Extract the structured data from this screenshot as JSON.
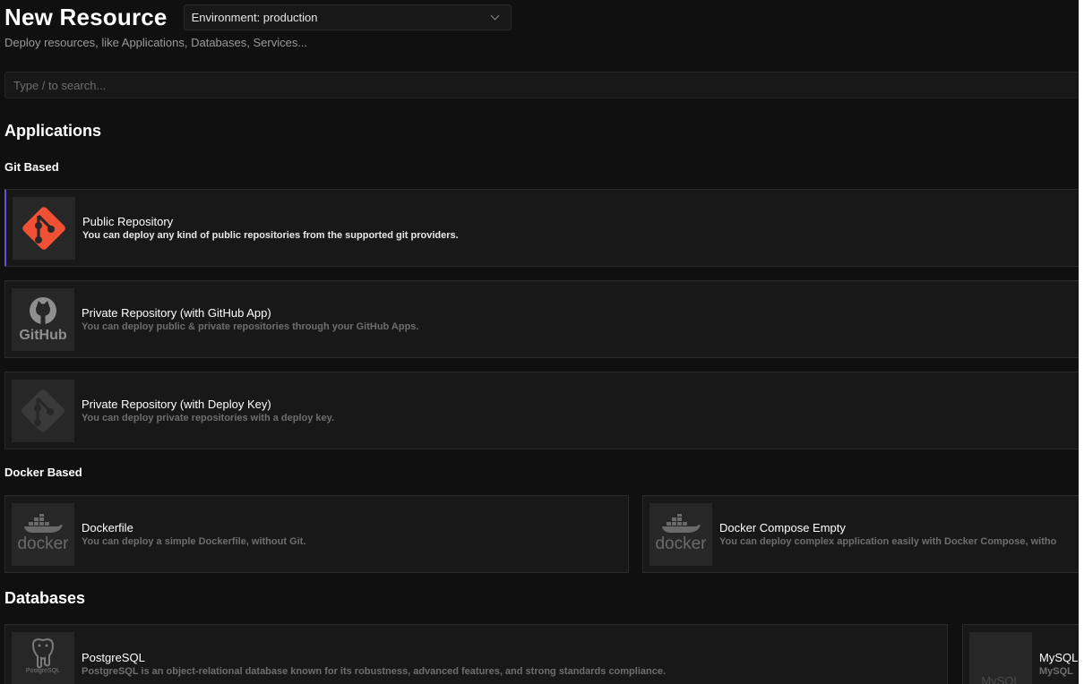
{
  "header": {
    "title": "New Resource",
    "environment_select": "Environment: production",
    "subtitle": "Deploy resources, like Applications, Databases, Services..."
  },
  "search": {
    "placeholder": "Type / to search..."
  },
  "applications": {
    "title": "Applications",
    "git_based": {
      "title": "Git Based",
      "items": [
        {
          "name": "Public Repository",
          "description": "You can deploy any kind of public repositories from the supported git providers.",
          "icon": "git-icon",
          "selected": true
        },
        {
          "name": "Private Repository (with GitHub App)",
          "description": "You can deploy public & private repositories through your GitHub Apps.",
          "icon": "github-icon",
          "logo_text": "GitHub"
        },
        {
          "name": "Private Repository (with Deploy Key)",
          "description": "You can deploy private repositories with a deploy key.",
          "icon": "git-icon"
        }
      ]
    },
    "docker_based": {
      "title": "Docker Based",
      "items": [
        {
          "name": "Dockerfile",
          "description": "You can deploy a simple Dockerfile, without Git.",
          "icon": "docker-icon",
          "logo_text": "docker"
        },
        {
          "name": "Docker Compose Empty",
          "description": "You can deploy complex application easily with Docker Compose, witho",
          "icon": "docker-icon",
          "logo_text": "docker"
        }
      ]
    }
  },
  "databases": {
    "title": "Databases",
    "items": [
      {
        "name": "PostgreSQL",
        "description": "PostgreSQL is an object-relational database known for its robustness, advanced features, and strong standards compliance.",
        "icon": "postgresql-icon",
        "logo_text": "PostgreSQL"
      },
      {
        "name": "MySQL",
        "description": "MySQL",
        "icon": "mysql-icon",
        "logo_text": "MySQL"
      }
    ]
  },
  "colors": {
    "background": "#101010",
    "card": "#181818",
    "git_brand": "#f05033",
    "accent": "#6b4fd8"
  }
}
